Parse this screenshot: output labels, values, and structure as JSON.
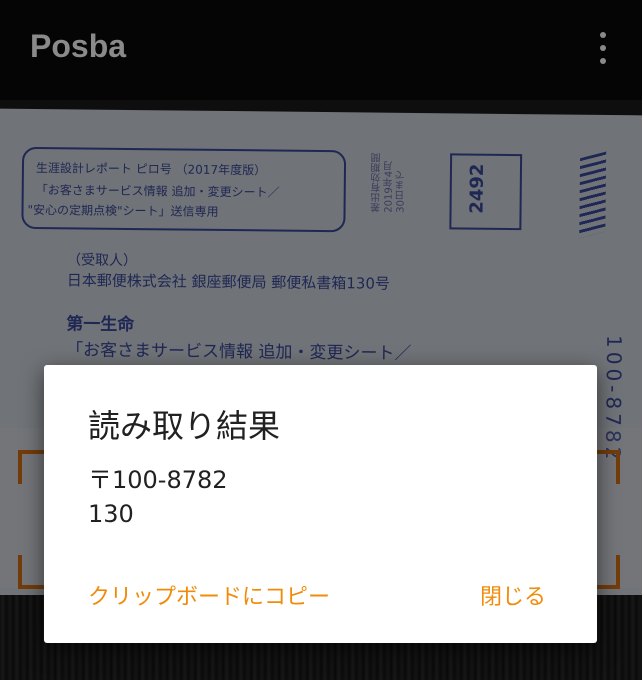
{
  "app": {
    "title": "Posba",
    "menu_icon": "overflow-menu-icon"
  },
  "camera_preview": {
    "postcard": {
      "box_line1": "生涯設計レポート ピロ号 （2017年度版）",
      "box_line2": "「お客さまサービス情報 追加・変更シート／",
      "box_line3": "\"安心の定期点検\"シート」送信専用",
      "recipient_label": "（受取人）",
      "address": "日本郵便株式会社 銀座郵便局 郵便私書箱130号",
      "company": "第一生命",
      "service": "「お客さまサービス情報 追加・変更シート／",
      "stamp_number": "2492",
      "vertical_zip": "100-8782"
    },
    "scan_bracket_color": "#d26e14"
  },
  "dialog": {
    "title": "読み取り結果",
    "result_lines": [
      "〒100-8782",
      "130"
    ],
    "copy_label": "クリップボードにコピー",
    "close_label": "閉じる",
    "accent_color": "#f08c0a"
  }
}
